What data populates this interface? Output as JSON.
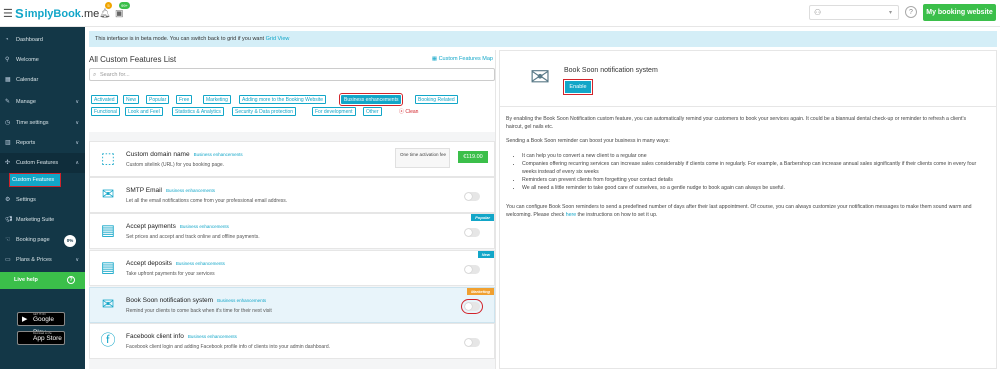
{
  "header": {
    "logo_s": "S",
    "logo_text": "implyBook",
    "logo_suffix": ".me",
    "badge_notifications": "5",
    "badge_calendar": "99+",
    "my_booking_website": "My booking website"
  },
  "sidebar": {
    "items": [
      {
        "label": "Dashboard",
        "icon": "dashboard-icon"
      },
      {
        "label": "Welcome",
        "icon": "pin-icon"
      },
      {
        "label": "Calendar",
        "icon": "calendar-icon"
      },
      {
        "label": "Manage",
        "icon": "pencil-icon"
      },
      {
        "label": "Time settings",
        "icon": "clock-icon"
      },
      {
        "label": "Reports",
        "icon": "chart-icon"
      },
      {
        "label": "Custom Features",
        "icon": "puzzle-icon"
      },
      {
        "label": "Settings",
        "icon": "gear-icon"
      },
      {
        "label": "Marketing Suite",
        "icon": "megaphone-icon"
      },
      {
        "label": "Booking page",
        "icon": "hand-icon"
      },
      {
        "label": "Plans & Prices",
        "icon": "card-icon"
      }
    ],
    "sub_item": "Custom Features",
    "booking_page_pct": "0%",
    "live_help": "Live help",
    "google_play_small": "GET IT ON",
    "google_play": "Google Play",
    "app_store_small": "Download on the",
    "app_store": "App Store"
  },
  "beta": {
    "text": "This interface is in beta mode. You can switch back to grid if you want",
    "link": "Grid View"
  },
  "features_list": {
    "title": "All Custom Features List",
    "map_link": "Custom Features Map",
    "search_placeholder": "Search for...",
    "tags_row1": [
      "Activated",
      "New",
      "Popular",
      "Free",
      "Marketing",
      "Adding more to the Booking Website",
      "Business enhancements",
      "Booking Related"
    ],
    "tags_row2": [
      "Functional",
      "Look and Feel",
      "Statistics & Analytics",
      "Security & Data protection",
      "For development",
      "Other"
    ],
    "clean": "Clean",
    "selected_tag": "Business enhancements"
  },
  "features": [
    {
      "title": "Custom domain name",
      "category": "Business enhancements",
      "desc": "Custom sitelink (URL) for you booking page.",
      "icon": "domain-icon",
      "price_label": "One time activation fee",
      "price": "€119.00"
    },
    {
      "title": "SMTP Email",
      "category": "Business enhancements",
      "desc": "Let all the email notifications come from your professional email address.",
      "icon": "email-icon"
    },
    {
      "title": "Accept payments",
      "category": "Business enhancements",
      "desc": "Set prices and accept and track online and offline payments.",
      "icon": "payments-icon",
      "ribbon": "Popular"
    },
    {
      "title": "Accept deposits",
      "category": "Business enhancements",
      "desc": "Take upfront payments for your services",
      "icon": "deposits-icon",
      "ribbon": "New"
    },
    {
      "title": "Book Soon notification system",
      "category": "Business enhancements",
      "desc": "Remind your clients to come back when it's time for their next visit",
      "icon": "book-soon-icon",
      "ribbon": "Marketing"
    },
    {
      "title": "Facebook client info",
      "category": "Business enhancements",
      "desc": "Facebook client login and adding Facebook profile info of clients into your admin dashboard.",
      "icon": "facebook-icon"
    }
  ],
  "colors": {
    "accent": "#12a6c8",
    "green": "#3bbf4a",
    "sidebar": "#133747",
    "highlight_red": "#d2232a",
    "ribbon_popular": "#12a6c8",
    "ribbon_new": "#12a6c8",
    "ribbon_marketing": "#f0a030"
  },
  "detail": {
    "title": "Book Soon notification system",
    "enable": "Enable",
    "para1": "By enabling the Book Soon Notification custom feature, you can automatically remind your customers to book your services again. It could be a biannual dental check-up or reminder to refresh a client's haircut, gel nails etc.",
    "para2": "Sending a Book Soon reminder can boost your business in many ways:",
    "bullets": [
      "It can help you to convert a new client to a regular one",
      "Companies offering recurring services can increase sales considerably if clients come in regularly. For example, a Barbershop can increase annual sales significantly if their clients come in every four weeks instead of every six weeks",
      "Reminders can prevent clients from forgetting your contact details",
      "We all need a little reminder to take good care of ourselves, so a gentle nudge to book again can always be useful."
    ],
    "para3_a": "You can configure Book Soon reminders to send a predefined number of days after their last appointment. Of course, you can always customize your notification messages to make them sound warm and welcoming. Please check",
    "para3_link": "here",
    "para3_b": "the instructions on how to set it up."
  }
}
